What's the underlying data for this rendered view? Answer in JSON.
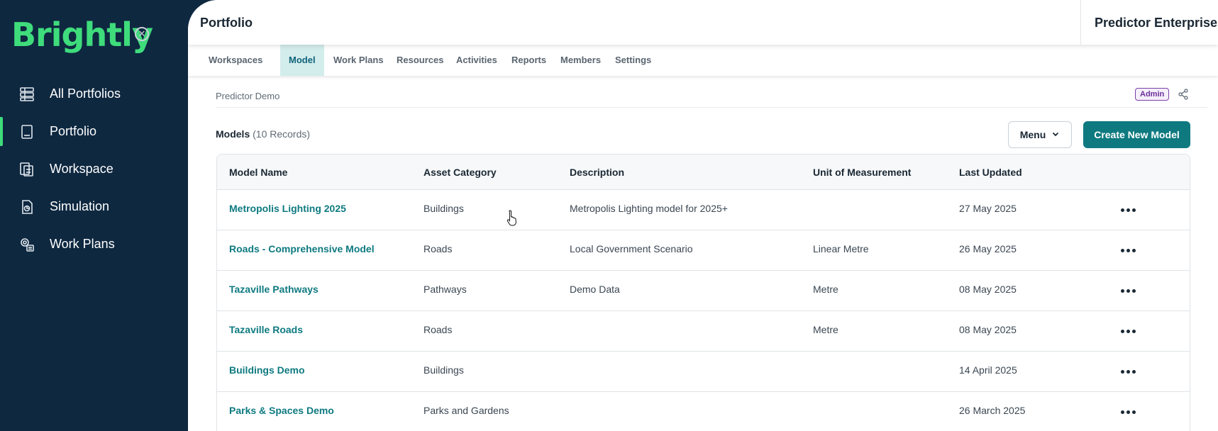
{
  "sidebar": {
    "logo_text": "Brightly",
    "items": [
      {
        "label": "All Portfolios",
        "icon": "portfolios-icon",
        "active": false
      },
      {
        "label": "Portfolio",
        "icon": "book-icon",
        "active": true
      },
      {
        "label": "Workspace",
        "icon": "workspace-icon",
        "active": false
      },
      {
        "label": "Simulation",
        "icon": "simulation-icon",
        "active": false
      },
      {
        "label": "Work Plans",
        "icon": "work-plans-icon",
        "active": false
      }
    ]
  },
  "header": {
    "title": "Portfolio",
    "product": "Predictor Enterprise"
  },
  "tabs": [
    {
      "label": "Workspaces",
      "active": false
    },
    {
      "label": "Model",
      "active": true
    },
    {
      "label": "Work Plans",
      "active": false
    },
    {
      "label": "Resources",
      "active": false
    },
    {
      "label": "Activities",
      "active": false
    },
    {
      "label": "Reports",
      "active": false
    },
    {
      "label": "Members",
      "active": false
    },
    {
      "label": "Settings",
      "active": false
    }
  ],
  "breadcrumb": {
    "label": "Predictor Demo",
    "badge": "Admin"
  },
  "models": {
    "heading": "Models",
    "count": "(10 Records)",
    "menu_label": "Menu",
    "create_label": "Create New Model",
    "columns": [
      "Model Name",
      "Asset Category",
      "Description",
      "Unit of Measurement",
      "Last Updated"
    ],
    "rows": [
      {
        "name": "Metropolis Lighting 2025",
        "category": "Buildings",
        "description": "Metropolis Lighting model for 2025+",
        "unit": "",
        "updated": "27 May 2025"
      },
      {
        "name": "Roads - Comprehensive Model",
        "category": "Roads",
        "description": "Local Government Scenario",
        "unit": "Linear Metre",
        "updated": "26 May 2025"
      },
      {
        "name": "Tazaville Pathways",
        "category": "Pathways",
        "description": "Demo Data",
        "unit": "Metre",
        "updated": "08 May 2025"
      },
      {
        "name": "Tazaville Roads",
        "category": "Roads",
        "description": "",
        "unit": "Metre",
        "updated": "08 May 2025"
      },
      {
        "name": "Buildings Demo",
        "category": "Buildings",
        "description": "",
        "unit": "",
        "updated": "14 April 2025"
      },
      {
        "name": "Parks & Spaces Demo",
        "category": "Parks and Gardens",
        "description": "",
        "unit": "",
        "updated": "26 March 2025"
      }
    ]
  },
  "colors": {
    "sidebar_bg": "#0e2840",
    "brand_green": "#3fdc7c",
    "teal": "#0e7a80",
    "active_tab_bg": "#d3ecec"
  }
}
